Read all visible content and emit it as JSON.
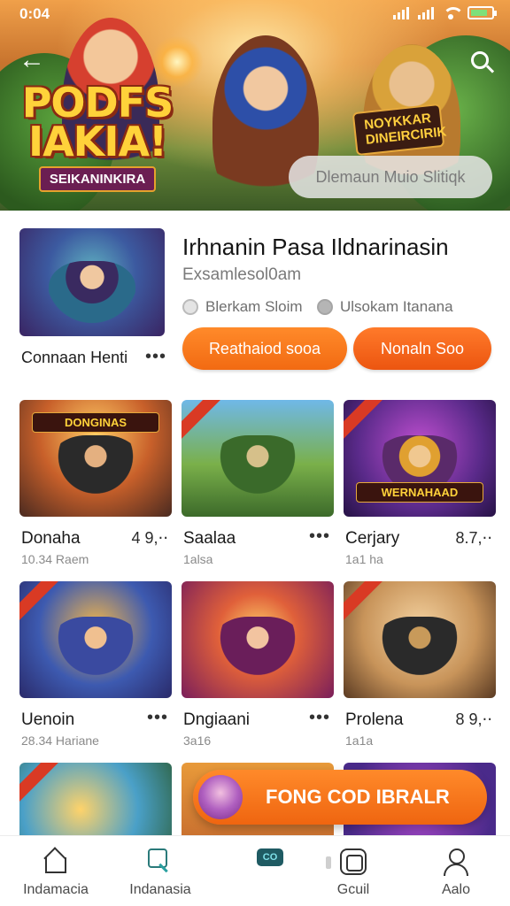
{
  "status_bar": {
    "time": "0:04"
  },
  "hero": {
    "logo_title": "PODFS\nIAKIA!",
    "logo_subtitle": "SEIKANINKIRA",
    "badge_text": "NOYKKAR DINEIRCIRIK",
    "pill_text": "Dlemaun Muio Slitiqk"
  },
  "featured": {
    "label": "Connaan Henti",
    "more": "•••",
    "title": "Irhnanin Pasa Ildnarinasin",
    "subtitle": "Exsamlesol0am",
    "meta_1": "Blerkam Sloim",
    "meta_2": "Ulsokam Itanana",
    "btn_primary": "Reathaiod sooa",
    "btn_secondary": "Nonaln Soo"
  },
  "games": [
    {
      "name": "Donaha",
      "right": "4 9,⋅⋅",
      "meta": "10.34 Raem",
      "caption": "DONGINAS"
    },
    {
      "name": "Saalaa",
      "right": "•••",
      "meta": "1alsa",
      "caption": ""
    },
    {
      "name": "Cerjary",
      "right": "8.7,⋅⋅",
      "meta": "1a1 ha",
      "caption": "WERNAHAAD"
    },
    {
      "name": "Uenoin",
      "right": "•••",
      "meta": "28.34 Hariane",
      "caption": ""
    },
    {
      "name": "Dngiaani",
      "right": "•••",
      "meta": "3a16",
      "caption": ""
    },
    {
      "name": "Prolena",
      "right": "8 9,⋅⋅",
      "meta": "1a1a",
      "caption": ""
    }
  ],
  "floating_cta": {
    "label": "FONG COD IBRALR"
  },
  "bottom_nav": [
    {
      "label": "Indamacia",
      "icon": "home-icon"
    },
    {
      "label": "Indanasia",
      "icon": "search-icon"
    },
    {
      "label": "",
      "icon": "games-icon",
      "badge": "CO"
    },
    {
      "label": "Gcuil",
      "icon": "console-icon"
    },
    {
      "label": "Aalo",
      "icon": "profile-icon"
    }
  ]
}
